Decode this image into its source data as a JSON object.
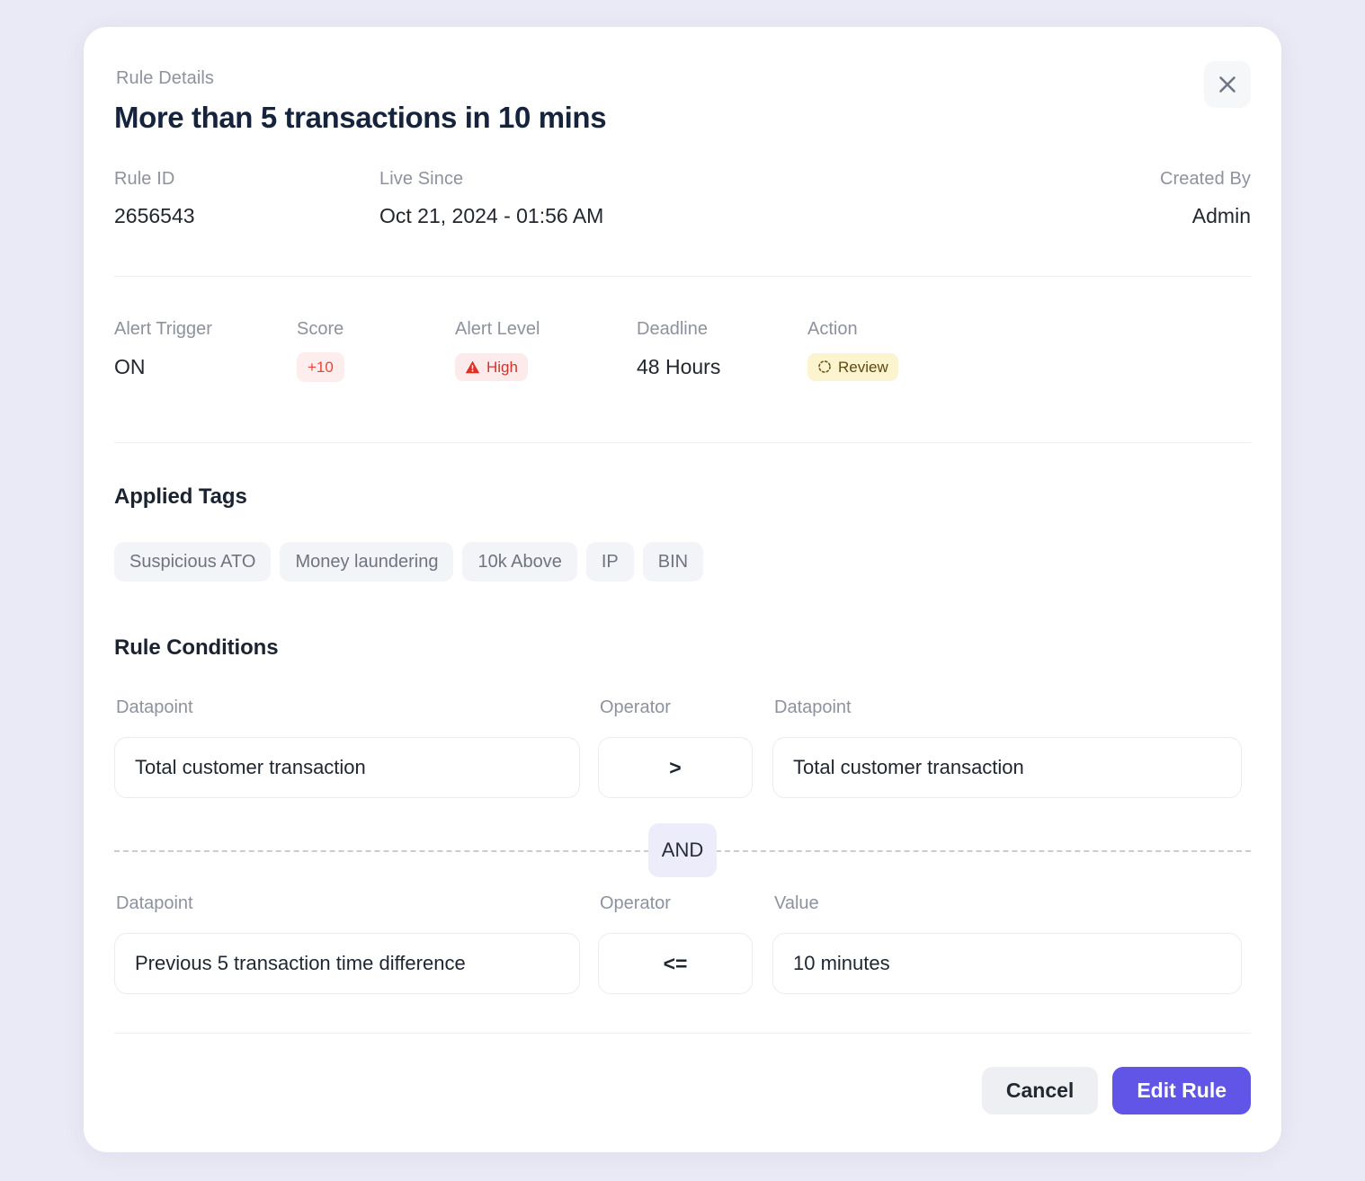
{
  "header": {
    "eyebrow": "Rule Details",
    "title": "More than 5 transactions in 10 mins",
    "close_icon": "close-icon"
  },
  "meta": {
    "rule_id": {
      "label": "Rule ID",
      "value": "2656543"
    },
    "live_since": {
      "label": "Live Since",
      "value": "Oct 21, 2024 - 01:56 AM"
    },
    "created_by": {
      "label": "Created By",
      "value": "Admin"
    }
  },
  "attributes": {
    "alert_trigger": {
      "label": "Alert Trigger",
      "value": "ON"
    },
    "score": {
      "label": "Score",
      "value": "+10"
    },
    "alert_level": {
      "label": "Alert Level",
      "value": "High",
      "icon": "warning-triangle-icon"
    },
    "deadline": {
      "label": "Deadline",
      "value": "48 Hours"
    },
    "action": {
      "label": "Action",
      "value": "Review",
      "icon": "dashed-circle-icon"
    }
  },
  "applied_tags": {
    "title": "Applied Tags",
    "items": [
      {
        "label": "Suspicious ATO"
      },
      {
        "label": "Money laundering"
      },
      {
        "label": "10k Above"
      },
      {
        "label": "IP"
      },
      {
        "label": "BIN"
      }
    ]
  },
  "rule_conditions": {
    "title": "Rule Conditions",
    "joiner": "AND",
    "rows": [
      {
        "left_label": "Datapoint",
        "left_value": "Total customer transaction",
        "operator_label": "Operator",
        "operator_value": ">",
        "right_label": "Datapoint",
        "right_value": "Total customer transaction"
      },
      {
        "left_label": "Datapoint",
        "left_value": "Previous 5 transaction time difference",
        "operator_label": "Operator",
        "operator_value": "<=",
        "right_label": "Value",
        "right_value": "10 minutes"
      }
    ]
  },
  "footer": {
    "cancel_label": "Cancel",
    "primary_label": "Edit Rule"
  },
  "colors": {
    "page_background": "#eaeaf6",
    "card_background": "#ffffff",
    "primary": "#6155e8",
    "title": "#15233d",
    "label": "#8d929e",
    "danger": "#d0342c",
    "score_bg": "#fdeeed",
    "level_bg": "#fdeaea",
    "action_bg": "#fcf3cf",
    "action_text": "#5c4a12",
    "tag_bg": "#f3f4f8",
    "tag_text": "#6f7480",
    "joiner_bg": "#edecfa"
  }
}
